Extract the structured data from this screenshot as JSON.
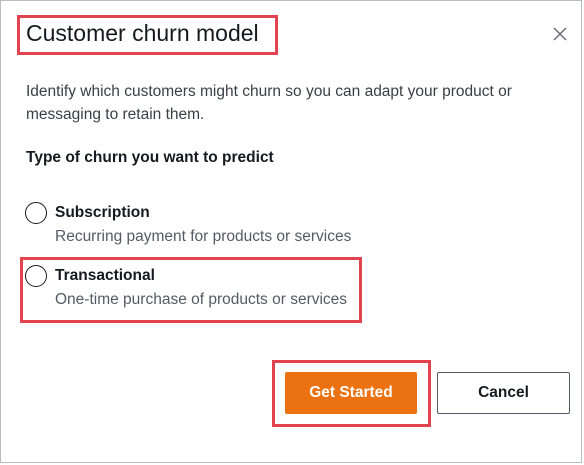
{
  "modal": {
    "title": "Customer churn model",
    "description": "Identify which customers might churn so you can adapt your product or messaging to retain them.",
    "section_label": "Type of churn you want to predict",
    "close_icon": "close-icon"
  },
  "options": [
    {
      "label": "Subscription",
      "description": "Recurring payment for products or services",
      "selected": false
    },
    {
      "label": "Transactional",
      "description": "One-time purchase of products or services",
      "selected": false
    }
  ],
  "buttons": {
    "primary_label": "Get Started",
    "secondary_label": "Cancel"
  },
  "colors": {
    "primary": "#ec7211",
    "highlight": "#e2444f"
  }
}
